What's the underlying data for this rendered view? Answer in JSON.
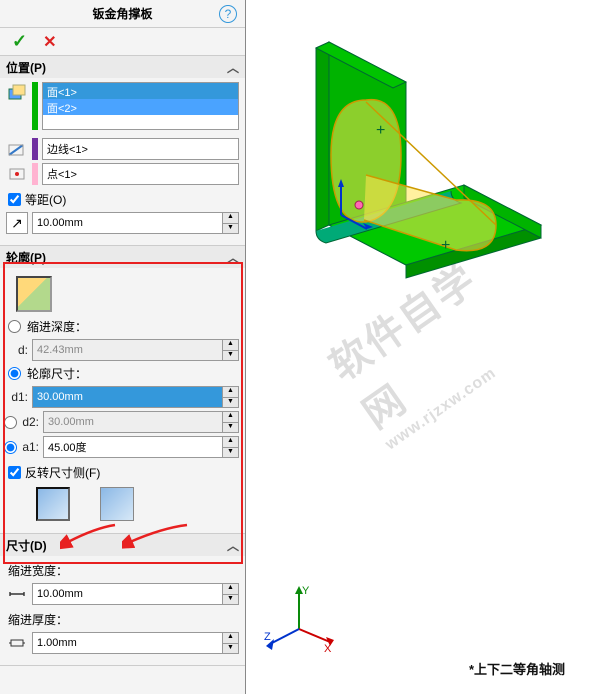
{
  "header": {
    "title": "钣金角撑板"
  },
  "position": {
    "label": "位置(P)",
    "faces": [
      "面<1>",
      "面<2>"
    ],
    "edge_placeholder": "边线<1>",
    "point_placeholder": "点<1>",
    "offset_label": "等距(O)",
    "offset_value": "10.00mm"
  },
  "profile": {
    "label": "轮廓(P)",
    "depth_label": "缩进深度：",
    "d_label": "d:",
    "d_value": "42.43mm",
    "size_label": "轮廓尺寸：",
    "d1_label": "d1:",
    "d1_value": "30.00mm",
    "d2_label": "d2:",
    "d2_value": "30.00mm",
    "a1_label": "a1:",
    "a1_value": "45.00度",
    "flip_label": "反转尺寸侧(F)"
  },
  "dimension": {
    "label": "尺寸(D)",
    "width_label": "缩进宽度：",
    "width_value": "10.00mm",
    "thick_label": "缩进厚度：",
    "thick_value": "1.00mm"
  },
  "viewport": {
    "watermark": "软件自学网",
    "watermark_url": "www.rjzxw.com",
    "status": "*上下二等角轴测",
    "axis_x": "X",
    "axis_y": "Y",
    "axis_z": "Z"
  }
}
